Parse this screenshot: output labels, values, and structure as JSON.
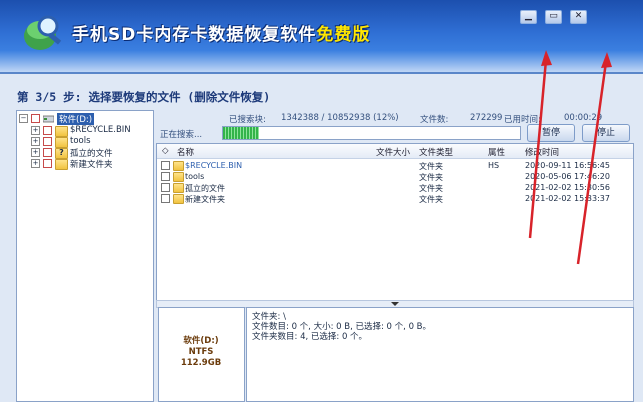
{
  "window": {
    "title_main": "手机SD卡内存卡数据恢复软件",
    "title_suffix": "免费版",
    "min_symbol": "▁",
    "max_symbol": "▭",
    "close_symbol": "✕"
  },
  "step_text": "第 3/5 步: 选择要恢复的文件 (删除文件恢复)",
  "tree": {
    "root": "软件(D:)",
    "children": [
      "$RECYCLE.BIN",
      "tools",
      "孤立的文件",
      "新建文件夹"
    ]
  },
  "scan": {
    "searched_label": "已搜索块:",
    "searched_value": "1342388 / 10852938 (12%)",
    "files_label": "文件数:",
    "files_value": "272299",
    "time_label": "已用时间:",
    "time_value": "00:00:29",
    "searching_label": "正在搜索...",
    "progress_fraction": 0.12,
    "pause_label": "暂停",
    "stop_label": "停止"
  },
  "table": {
    "columns": [
      "名称",
      "文件大小",
      "文件类型",
      "属性",
      "修改时间"
    ],
    "rows": [
      {
        "name": "$RECYCLE.BIN",
        "size": "",
        "type": "文件夹",
        "attr": "HS",
        "mtime": "2020-09-11 16:56:45"
      },
      {
        "name": "tools",
        "size": "",
        "type": "文件夹",
        "attr": "",
        "mtime": "2020-05-06 17:46:20"
      },
      {
        "name": "孤立的文件",
        "size": "",
        "type": "文件夹",
        "attr": "",
        "mtime": "2021-02-02 15:30:56"
      },
      {
        "name": "新建文件夹",
        "size": "",
        "type": "文件夹",
        "attr": "",
        "mtime": "2021-02-02 15:33:37"
      }
    ]
  },
  "drive_info": {
    "name": "软件(D:)",
    "fs": "NTFS",
    "size": "112.9GB"
  },
  "detail": {
    "line1": "文件夹: \\",
    "line2": "文件数目: 0 个, 大小: 0 B, 已选择: 0 个, 0 B。",
    "line3": "文件夹数目: 4, 已选择: 0 个。"
  },
  "colors": {
    "title_bg": "#2f6fd4",
    "accent_arrow": "#d8232a",
    "progress": "#33b44a"
  }
}
